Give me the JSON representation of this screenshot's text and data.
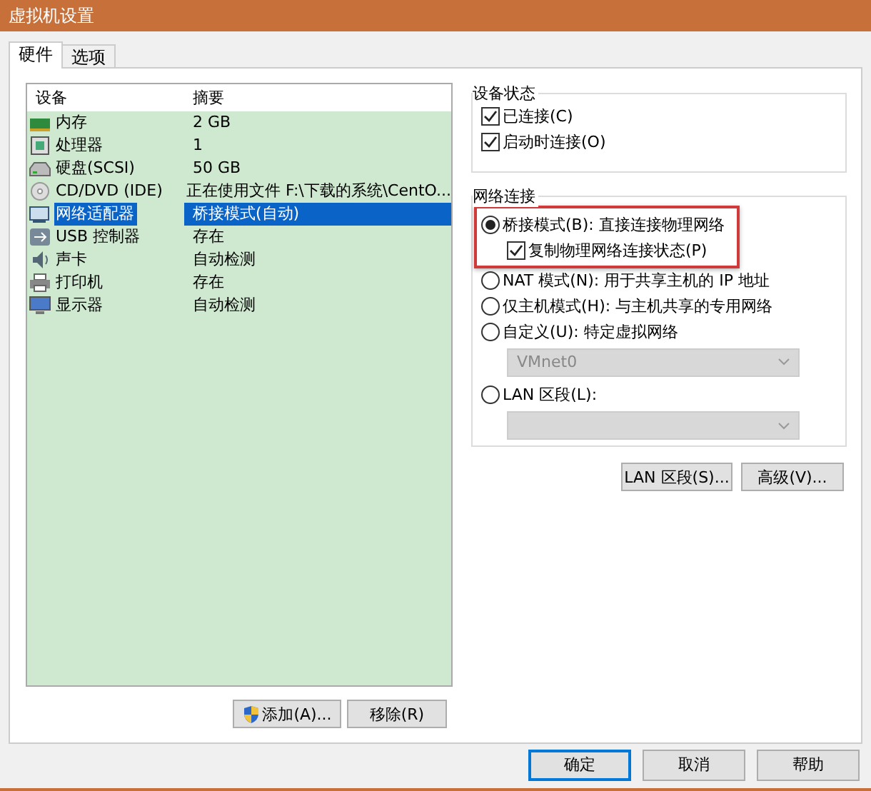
{
  "window": {
    "title": "虚拟机设置"
  },
  "tabs": [
    {
      "label": "硬件",
      "selected": true
    },
    {
      "label": "选项",
      "selected": false
    }
  ],
  "device_table": {
    "columns": [
      "设备",
      "摘要"
    ],
    "rows": [
      {
        "kind": "memory",
        "device": "内存",
        "summary": "2 GB",
        "selected": false
      },
      {
        "kind": "cpu",
        "device": "处理器",
        "summary": "1",
        "selected": false
      },
      {
        "kind": "disk",
        "device": "硬盘(SCSI)",
        "summary": "50 GB",
        "selected": false
      },
      {
        "kind": "cd",
        "device": "CD/DVD (IDE)",
        "summary": "正在使用文件 F:\\下载的系统\\CentO...",
        "selected": false
      },
      {
        "kind": "network",
        "device": "网络适配器",
        "summary": "桥接模式(自动)",
        "selected": true
      },
      {
        "kind": "usb",
        "device": "USB 控制器",
        "summary": "存在",
        "selected": false
      },
      {
        "kind": "sound",
        "device": "声卡",
        "summary": "自动检测",
        "selected": false
      },
      {
        "kind": "printer",
        "device": "打印机",
        "summary": "存在",
        "selected": false
      },
      {
        "kind": "monitor",
        "device": "显示器",
        "summary": "自动检测",
        "selected": false
      }
    ]
  },
  "device_buttons": [
    {
      "label": "添加(A)...",
      "shield": true
    },
    {
      "label": "移除(R)",
      "shield": false
    }
  ],
  "device_status": {
    "title": "设备状态",
    "options": [
      {
        "label": "已连接(C)",
        "checked": true
      },
      {
        "label": "启动时连接(O)",
        "checked": true
      }
    ]
  },
  "network": {
    "title": "网络连接",
    "options": [
      {
        "kind": "radio",
        "label": "桥接模式(B): 直接连接物理网络",
        "selected": true,
        "highlighted": true
      },
      {
        "kind": "checkbox",
        "label": "复制物理网络连接状态(P)",
        "checked": true,
        "highlighted": true
      },
      {
        "kind": "radio",
        "label": "NAT 模式(N): 用于共享主机的 IP 地址",
        "selected": false,
        "highlighted": false
      },
      {
        "kind": "radio",
        "label": "仅主机模式(H): 与主机共享的专用网络",
        "selected": false,
        "highlighted": false
      },
      {
        "kind": "radio",
        "label": "自定义(U): 特定虚拟网络",
        "selected": false,
        "highlighted": false
      },
      {
        "kind": "select",
        "value": "VMnet0",
        "disabled": true,
        "highlighted": false
      },
      {
        "kind": "radio",
        "label": "LAN 区段(L):",
        "selected": false,
        "highlighted": false
      },
      {
        "kind": "select",
        "disabled": true,
        "highlighted": false
      }
    ]
  },
  "network_buttons": [
    "LAN 区段(S)...",
    "高级(V)..."
  ],
  "footer_buttons": [
    {
      "label": "确定",
      "default": true
    },
    {
      "label": "取消",
      "default": false
    },
    {
      "label": "帮助",
      "default": false
    }
  ]
}
